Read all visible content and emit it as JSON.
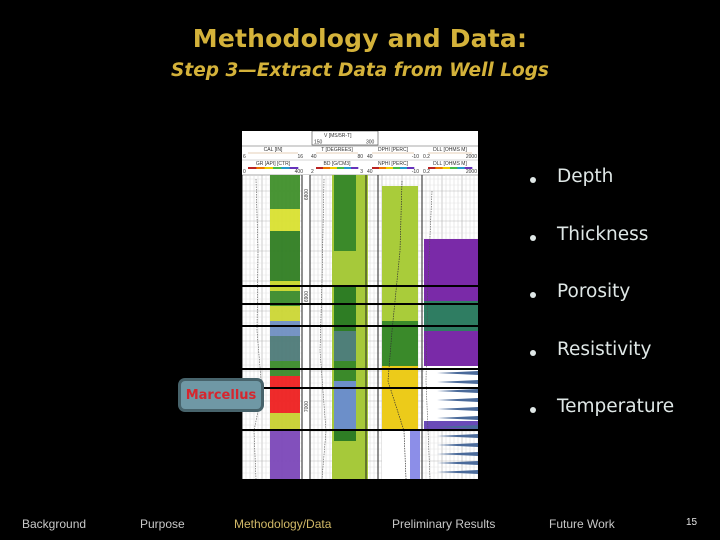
{
  "slide": {
    "title": "Methodology and Data:",
    "subtitle": "Step 3—Extract Data from Well Logs",
    "page_number": "15",
    "title_color": "#d4b23a"
  },
  "well_log": {
    "header": {
      "top_scale": {
        "label": "V [MS/5R-T]",
        "min": "150",
        "max": "300"
      },
      "tracks": [
        {
          "curve1": "CAL [IN]",
          "min1": "6",
          "max1": "16",
          "curve2": "GR [API] [CTR]",
          "min2": "0",
          "max2": "400"
        },
        {
          "curve1": "T [DEGREES]",
          "min1": "40",
          "max1": "80",
          "curve2": "BD [G/CM3]",
          "min2": "2",
          "max2": "3"
        },
        {
          "curve1": "DPHI [PERC]",
          "min1": "40",
          "max1": "-10",
          "curve2": "NPHI [PERC]",
          "min2": "40",
          "max2": "-10"
        },
        {
          "curve1": "DLL [OHMS M]",
          "min1": "0.2",
          "max1": "2000",
          "curve2": "DLL [OHMS M]",
          "min2": "0.2",
          "max2": "2000"
        }
      ]
    },
    "depth_labels": [
      "6800",
      "6900",
      "7000"
    ],
    "formation_label": "Marcellus"
  },
  "bullets": [
    {
      "text": "Depth"
    },
    {
      "text": "Thickness"
    },
    {
      "text": "Porosity"
    },
    {
      "text": "Resistivity"
    },
    {
      "text": "Temperature"
    }
  ],
  "footer": {
    "items": [
      {
        "label": "Background",
        "active": false
      },
      {
        "label": "Purpose",
        "active": false
      },
      {
        "label": "Methodology/Data",
        "active": true
      },
      {
        "label": "Preliminary Results",
        "active": false
      },
      {
        "label": "Future Work",
        "active": false
      }
    ],
    "active_color": "#d2b968"
  }
}
